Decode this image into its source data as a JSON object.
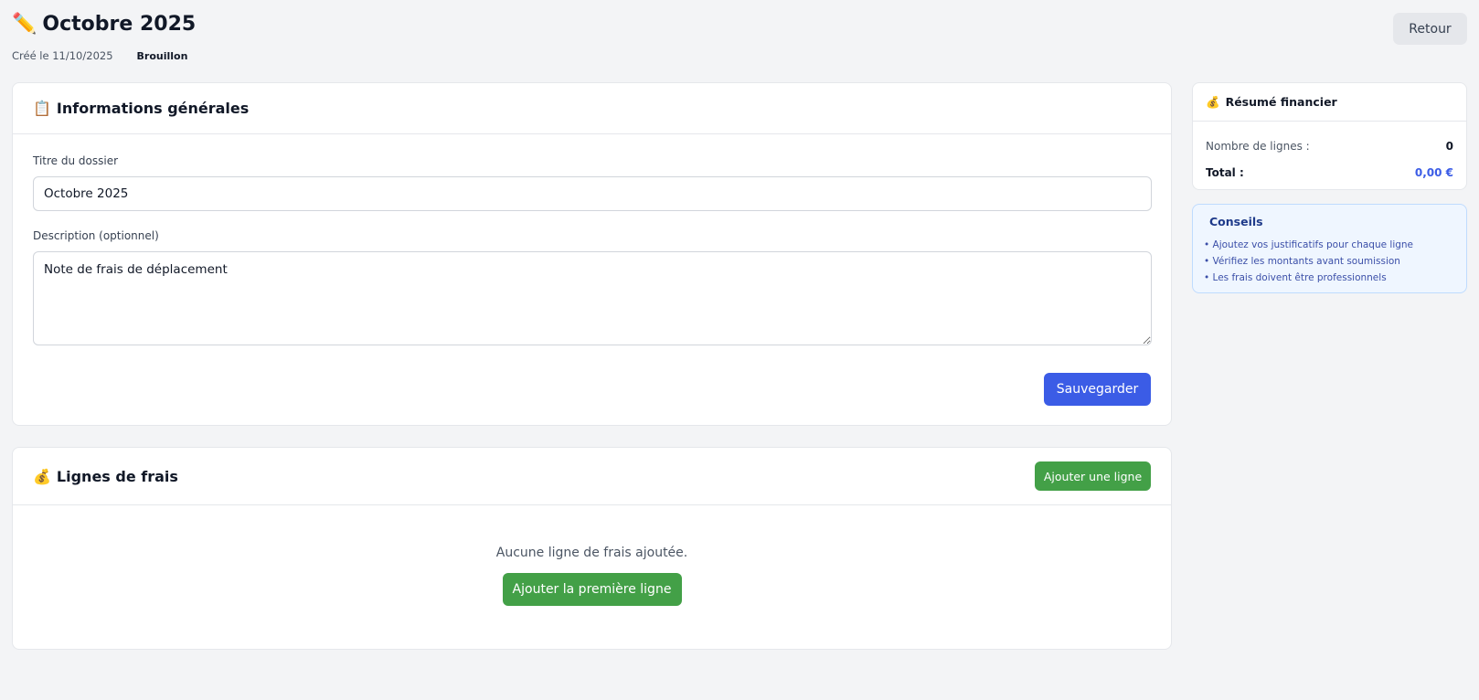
{
  "header": {
    "title_emoji": "✏️",
    "title": "Octobre 2025",
    "created": "Créé le 11/10/2025",
    "status": "Brouillon",
    "back_label": "Retour"
  },
  "general": {
    "emoji": "📋",
    "title": "Informations générales",
    "title_label": "Titre du dossier",
    "title_value": "Octobre 2025",
    "description_label": "Description (optionnel)",
    "description_value": "Note de frais de déplacement",
    "save_label": "Sauvegarder"
  },
  "lines": {
    "emoji": "💰",
    "title": "Lignes de frais",
    "add_label": "Ajouter une ligne",
    "empty_text": "Aucune ligne de frais ajoutée.",
    "add_first_label": "Ajouter la première ligne"
  },
  "summary": {
    "emoji": "💰",
    "title": "Résumé financier",
    "count_label": "Nombre de lignes :",
    "count_value": "0",
    "total_label": "Total :",
    "total_value": "0,00 €"
  },
  "tips": {
    "title": "Conseils",
    "items": [
      "• Ajoutez vos justificatifs pour chaque ligne",
      "• Vérifiez les montants avant soumission",
      "• Les frais doivent être professionnels"
    ]
  },
  "colors": {
    "primary": "#3b5ce6",
    "success": "#43a047",
    "background": "#f3f4f6",
    "tips_bg": "#eff6ff"
  }
}
